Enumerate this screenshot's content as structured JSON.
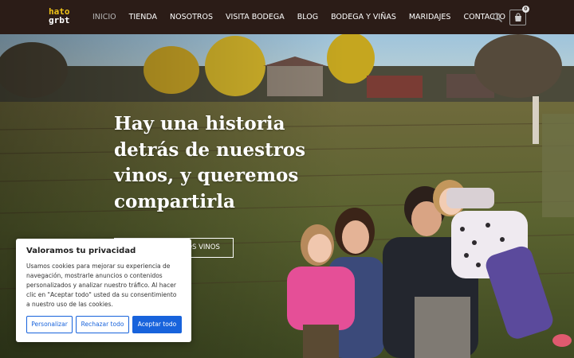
{
  "header": {
    "logo_line1": "hato",
    "logo_line2": "grbt",
    "nav": [
      {
        "label": "Inicio",
        "active": true
      },
      {
        "label": "Tienda"
      },
      {
        "label": "Nosotros"
      },
      {
        "label": "Visita Bodega"
      },
      {
        "label": "Blog"
      },
      {
        "label": "Bodega y Viñas"
      },
      {
        "label": "Maridajes"
      },
      {
        "label": "Contacto"
      }
    ],
    "search_icon": "search-icon",
    "cart_icon": "cart-icon",
    "cart_count": "0"
  },
  "hero": {
    "title": "Hay una historia detrás de nuestros vinos, y queremos compartirla",
    "cta_label": "Conoce nuestros vinos"
  },
  "cookie": {
    "title": "Valoramos tu privacidad",
    "text": "Usamos cookies para mejorar su experiencia de navegación, mostrarle anuncios o contenidos personalizados y analizar nuestro tráfico. Al hacer clic en \"Aceptar todo\" usted da su consentimiento a nuestro uso de las cookies.",
    "btn_customize": "Personalizar",
    "btn_reject": "Rechazar todo",
    "btn_accept": "Aceptar todo"
  },
  "colors": {
    "header_bg": "#2b1c17",
    "logo_accent": "#f0c419",
    "cookie_button": "#1863dc"
  }
}
